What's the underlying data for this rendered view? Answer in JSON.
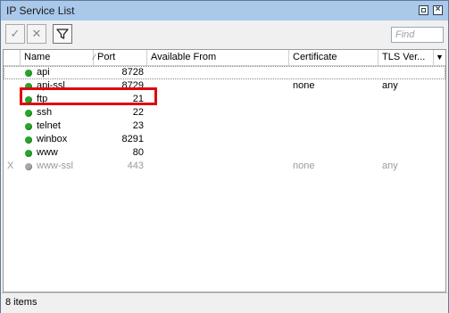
{
  "window": {
    "title": "IP Service List"
  },
  "toolbar": {
    "enable_icon": "✓",
    "disable_icon": "✕",
    "filter_icon": "filter",
    "find_placeholder": "Find"
  },
  "table": {
    "columns": [
      "Name",
      "Port",
      "Available From",
      "Certificate",
      "TLS Ver..."
    ],
    "rows": [
      {
        "flag": "",
        "name": "api",
        "port": "8728",
        "available_from": "",
        "certificate": "",
        "tls": "",
        "state": "enabled"
      },
      {
        "flag": "",
        "name": "api-ssl",
        "port": "8729",
        "available_from": "",
        "certificate": "none",
        "tls": "any",
        "state": "enabled"
      },
      {
        "flag": "",
        "name": "ftp",
        "port": "21",
        "available_from": "",
        "certificate": "",
        "tls": "",
        "state": "enabled"
      },
      {
        "flag": "",
        "name": "ssh",
        "port": "22",
        "available_from": "",
        "certificate": "",
        "tls": "",
        "state": "enabled"
      },
      {
        "flag": "",
        "name": "telnet",
        "port": "23",
        "available_from": "",
        "certificate": "",
        "tls": "",
        "state": "enabled"
      },
      {
        "flag": "",
        "name": "winbox",
        "port": "8291",
        "available_from": "",
        "certificate": "",
        "tls": "",
        "state": "enabled"
      },
      {
        "flag": "",
        "name": "www",
        "port": "80",
        "available_from": "",
        "certificate": "",
        "tls": "",
        "state": "enabled"
      },
      {
        "flag": "X",
        "name": "www-ssl",
        "port": "443",
        "available_from": "",
        "certificate": "none",
        "tls": "any",
        "state": "disabled"
      }
    ]
  },
  "status": {
    "count_text": "8 items"
  },
  "colors": {
    "titlebar": "#a9c8ea",
    "enabled_dot": "#27a52b",
    "disabled_dot": "#a8a8a8",
    "highlight": "#e0070d"
  }
}
